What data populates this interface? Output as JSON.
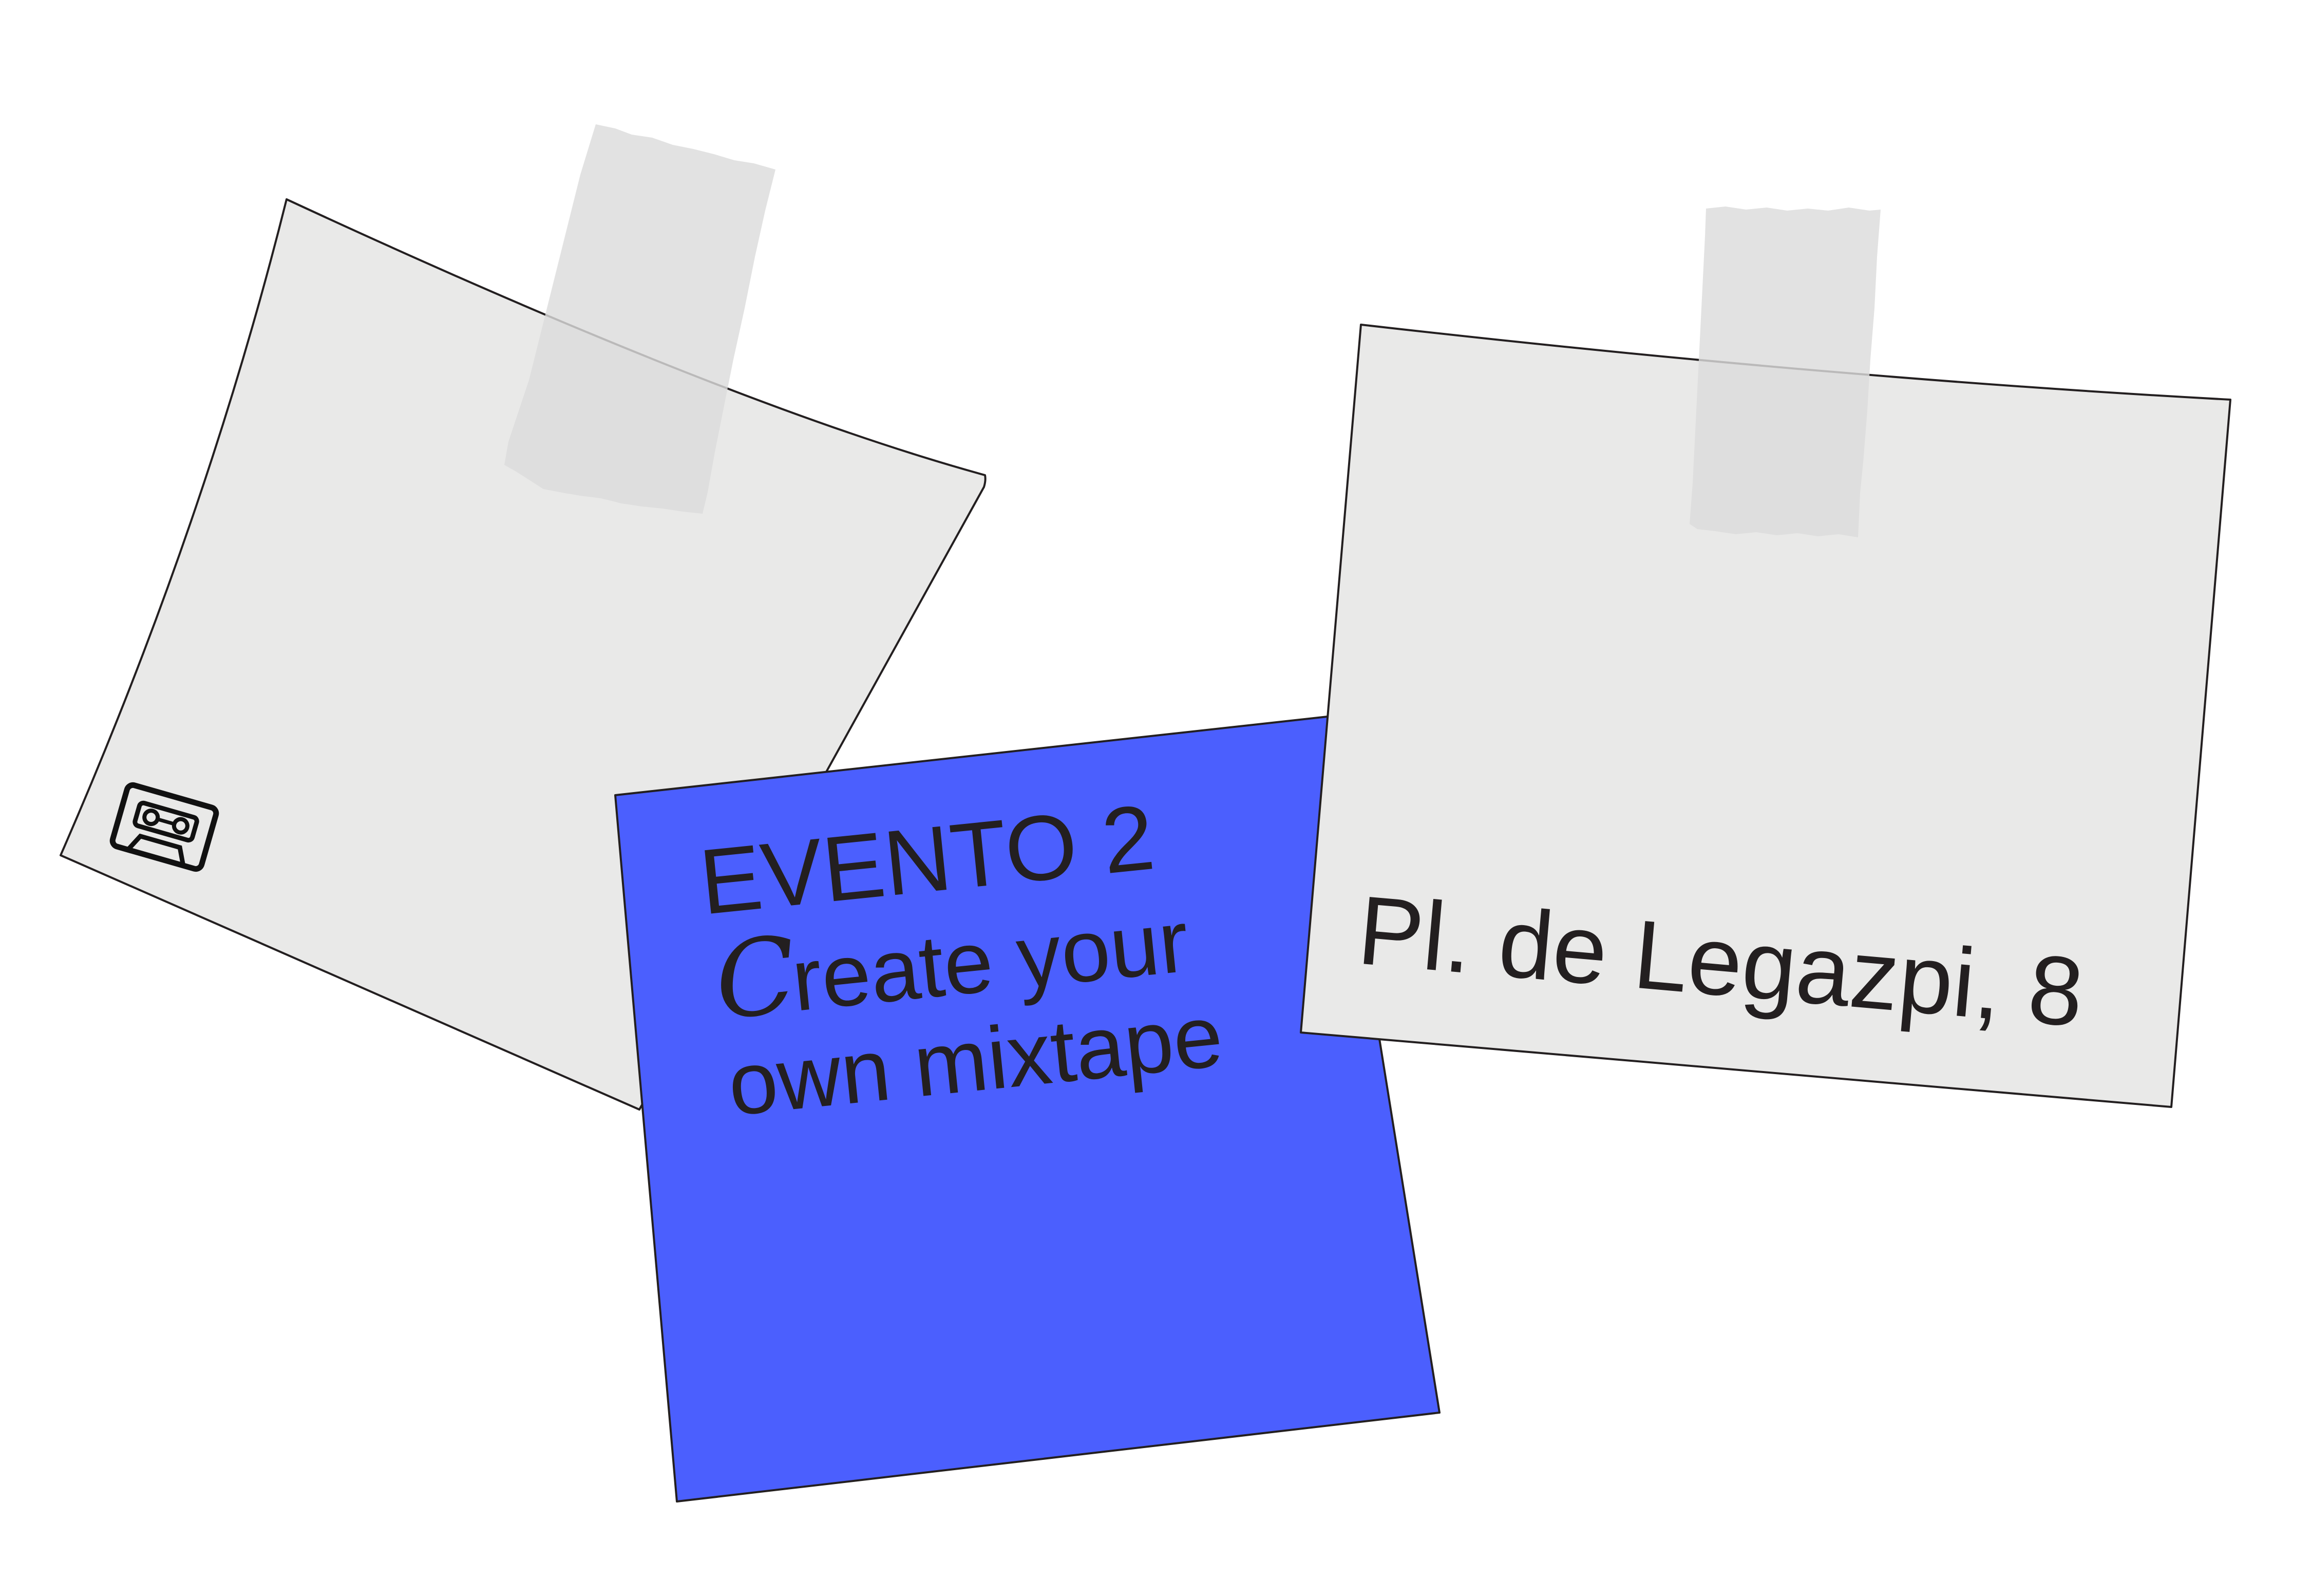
{
  "notes": {
    "left_note": {
      "icon": "cassette-tape-icon",
      "color": "#e9e9e8"
    },
    "event_note": {
      "title": "EVENTO 2",
      "subtitle_initial": "C",
      "subtitle_rest": "reate your",
      "subtitle_line2": "own mixtape",
      "color": "#4b5ffe"
    },
    "address_note": {
      "address": "Pl. de Legazpi, 8",
      "color": "#e9e9e8"
    }
  },
  "tape_color": "#dcdcdc"
}
